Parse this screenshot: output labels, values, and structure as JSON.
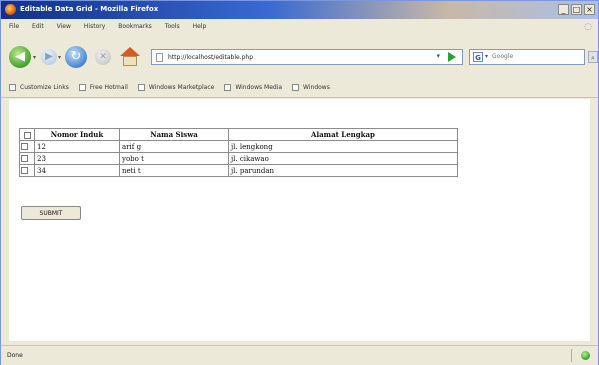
{
  "window": {
    "title": "Editable Data Grid - Mozilla Firefox",
    "buttons": {
      "minimize": "_",
      "maximize": "□",
      "close": "×"
    }
  },
  "menu": {
    "items": [
      {
        "label": "File"
      },
      {
        "label": "Edit"
      },
      {
        "label": "View"
      },
      {
        "label": "History"
      },
      {
        "label": "Bookmarks"
      },
      {
        "label": "Tools"
      },
      {
        "label": "Help"
      }
    ]
  },
  "nav": {
    "url": "http://localhost/editable.php",
    "search_placeholder": "Google",
    "icons": [
      "back-arrow-icon",
      "forward-arrow-icon",
      "reload-icon",
      "stop-icon",
      "home-icon",
      "go-arrow-icon",
      "google-icon"
    ]
  },
  "bookmarks": {
    "items": [
      {
        "label": "Customize Links"
      },
      {
        "label": "Free Hotmail"
      },
      {
        "label": "Windows Marketplace"
      },
      {
        "label": "Windows Media"
      },
      {
        "label": "Windows"
      }
    ]
  },
  "grid": {
    "columns": [
      "Nomor Induk",
      "Nama Siswa",
      "Alamat Lengkap"
    ],
    "rows": [
      {
        "nomor": "12",
        "nama": "arif g",
        "alamat": "jl. lengkong"
      },
      {
        "nomor": "23",
        "nama": "yobo t",
        "alamat": "jl. cikawao"
      },
      {
        "nomor": "34",
        "nama": "neti t",
        "alamat": "jl. parundan"
      }
    ],
    "submit_label": "SUBMIT"
  },
  "status": {
    "text": "Done"
  },
  "colors": {
    "title_start": "#10308a",
    "title_end": "#a9c0e8",
    "go": "#2f9e34",
    "status_ok": "#2e9a20"
  }
}
